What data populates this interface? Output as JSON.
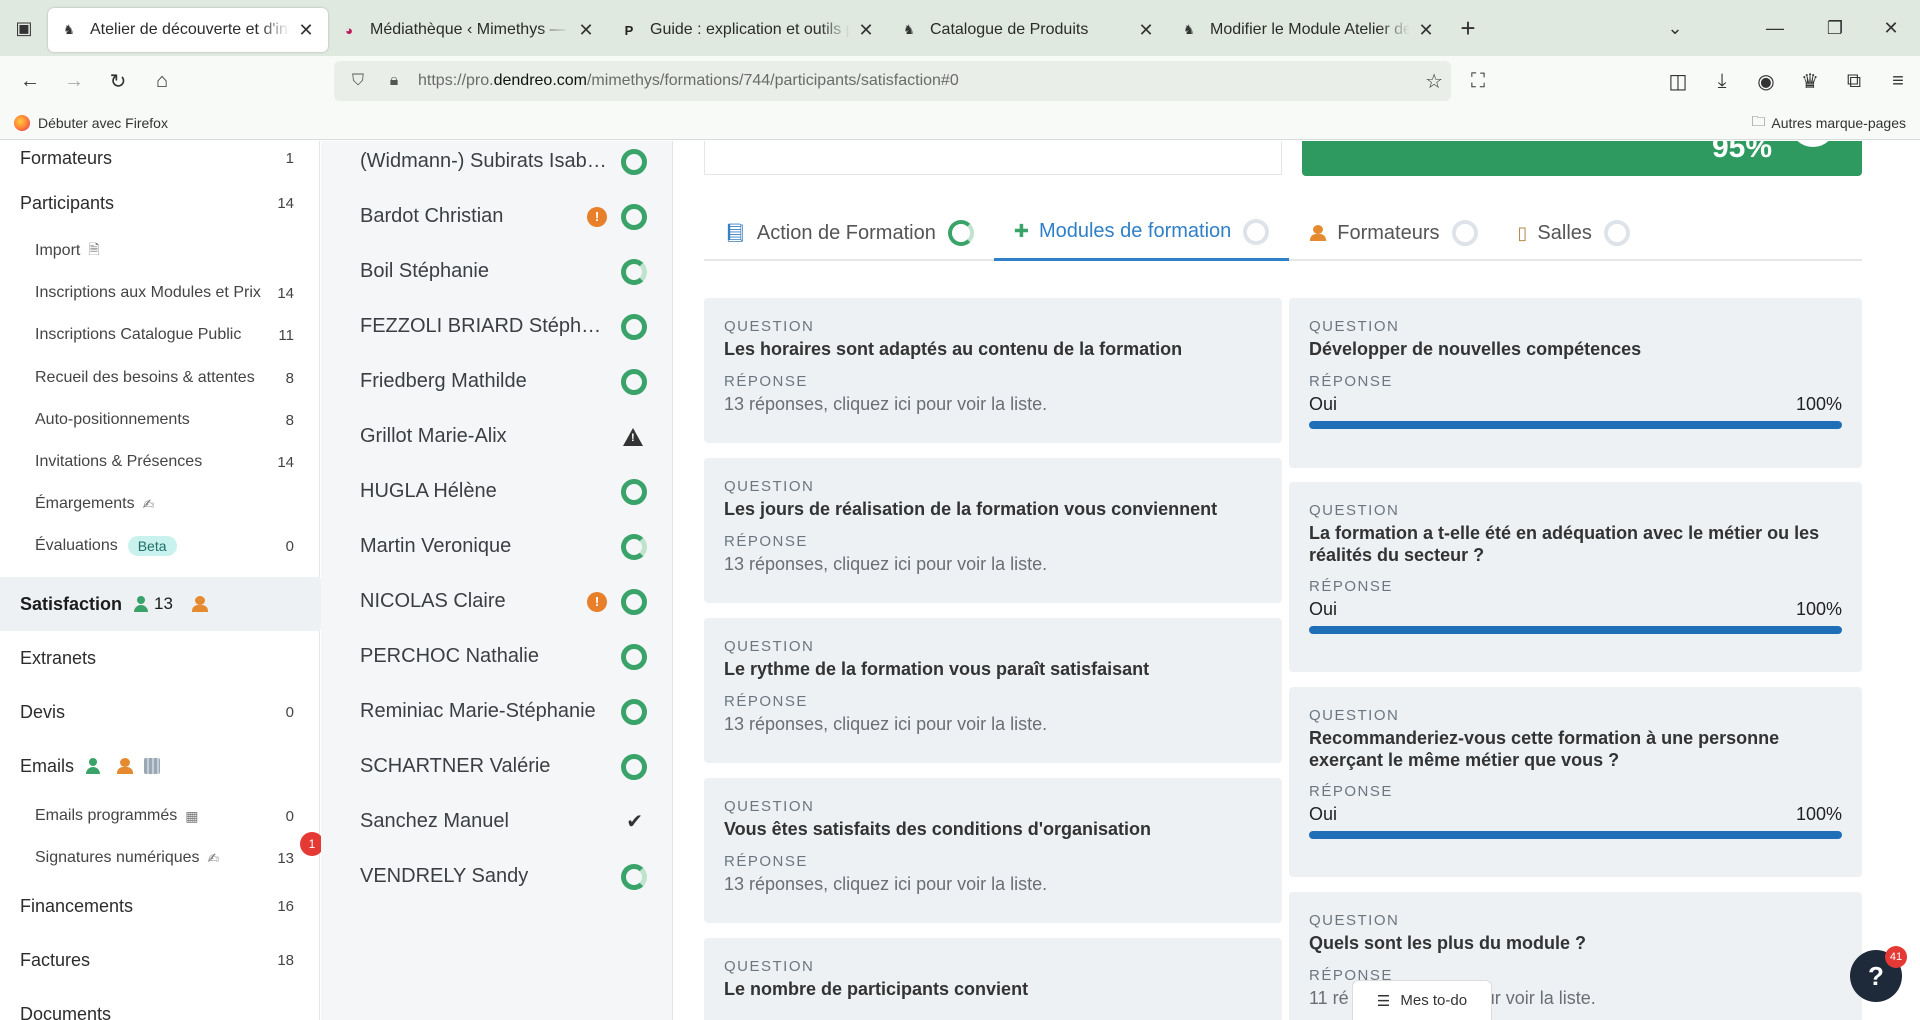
{
  "browser": {
    "tabs": [
      {
        "title": "Atelier de découverte et d'initia",
        "active": true
      },
      {
        "title": "Médiathèque ‹ Mimethys — Wo",
        "active": false
      },
      {
        "title": "Guide : explication et outils pou",
        "active": false
      },
      {
        "title": "Catalogue de Produits",
        "active": false
      },
      {
        "title": "Modifier le Module Atelier de d",
        "active": false
      }
    ],
    "url_prefix": "https://pro.",
    "url_domain": "dendreo.com",
    "url_path": "/mimethys/formations/744/participants/satisfaction#0",
    "bookmark_firefox": "Débuter avec Firefox",
    "bookmark_other": "Autres marque-pages"
  },
  "sidebar": {
    "formateurs": {
      "label": "Formateurs",
      "count": "1"
    },
    "participants": {
      "label": "Participants",
      "count": "14"
    },
    "import": {
      "label": "Import"
    },
    "inscriptions_modules": {
      "label": "Inscriptions aux Modules et Prix",
      "count": "14"
    },
    "inscriptions_catalogue": {
      "label": "Inscriptions Catalogue Public",
      "count": "11"
    },
    "recueil": {
      "label": "Recueil des besoins & attentes",
      "count": "8"
    },
    "auto": {
      "label": "Auto-positionnements",
      "count": "8"
    },
    "invitations": {
      "label": "Invitations & Présences",
      "count": "14"
    },
    "emargements": {
      "label": "Émargements"
    },
    "evaluations": {
      "label": "Évaluations",
      "badge": "Beta",
      "count": "0"
    },
    "satisfaction": {
      "label": "Satisfaction",
      "count": "13"
    },
    "extranets": {
      "label": "Extranets"
    },
    "devis": {
      "label": "Devis",
      "count": "0"
    },
    "emails": {
      "label": "Emails"
    },
    "emails_programmes": {
      "label": "Emails programmés",
      "count": "0"
    },
    "signatures": {
      "label": "Signatures numériques",
      "count": "13",
      "notification": "1"
    },
    "financements": {
      "label": "Financements",
      "count": "16"
    },
    "factures": {
      "label": "Factures",
      "count": "18"
    },
    "documents": {
      "label": "Documents"
    }
  },
  "participants": [
    {
      "name": "(Widmann-) Subirats Isab…",
      "status": "complete"
    },
    {
      "name": "Bardot Christian",
      "status": "complete",
      "warning": true
    },
    {
      "name": "Boil Stéphanie",
      "status": "partial"
    },
    {
      "name": "FEZZOLI BRIARD Stéphanie",
      "status": "complete"
    },
    {
      "name": "Friedberg Mathilde",
      "status": "complete"
    },
    {
      "name": "Grillot Marie-Alix",
      "status": "alert"
    },
    {
      "name": "HUGLA Hélène",
      "status": "complete"
    },
    {
      "name": "Martin Veronique",
      "status": "partial"
    },
    {
      "name": "NICOLAS Claire",
      "status": "complete",
      "warning": true
    },
    {
      "name": "PERCHOC Nathalie",
      "status": "complete"
    },
    {
      "name": "Reminiac Marie-Stéphanie",
      "status": "complete"
    },
    {
      "name": "SCHARTNER Valérie",
      "status": "complete"
    },
    {
      "name": "Sanchez Manuel",
      "status": "done"
    },
    {
      "name": "VENDRELY Sandy",
      "status": "partial"
    }
  ],
  "summary": {
    "percent": "95%"
  },
  "tabs": {
    "action": "Action de Formation",
    "modules": "Modules de formation",
    "formateurs": "Formateurs",
    "salles": "Salles"
  },
  "labels": {
    "question": "QUESTION",
    "reponse": "RÉPONSE"
  },
  "left_questions": [
    {
      "q": "Les horaires sont adaptés au contenu de la formation",
      "a": "13 réponses, cliquez ici pour voir la liste."
    },
    {
      "q": "Les jours de réalisation de la formation vous conviennent",
      "a": "13 réponses, cliquez ici pour voir la liste."
    },
    {
      "q": "Le rythme de la formation vous paraît satisfaisant",
      "a": "13 réponses, cliquez ici pour voir la liste."
    },
    {
      "q": "Vous êtes satisfaits des conditions d'organisation",
      "a": "13 réponses, cliquez ici pour voir la liste."
    },
    {
      "q": "Le nombre de participants convient",
      "a": ""
    }
  ],
  "right_questions": [
    {
      "q": "Développer de nouvelles compétences",
      "answer": "Oui",
      "pct": "100%",
      "value": 100
    },
    {
      "q": "La formation a t-elle été en adéquation avec le métier ou les réalités du secteur ?",
      "answer": "Oui",
      "pct": "100%",
      "value": 100
    },
    {
      "q": "Recommanderiez-vous cette formation à une personne exerçant le même métier que vous ?",
      "answer": "Oui",
      "pct": "100%",
      "value": 100
    },
    {
      "q": "Quels sont les plus du module ?",
      "a_start": "11 ré",
      "a_end": "pour voir la liste."
    }
  ],
  "widgets": {
    "todo": "Mes to-do",
    "help_badge": "41"
  }
}
